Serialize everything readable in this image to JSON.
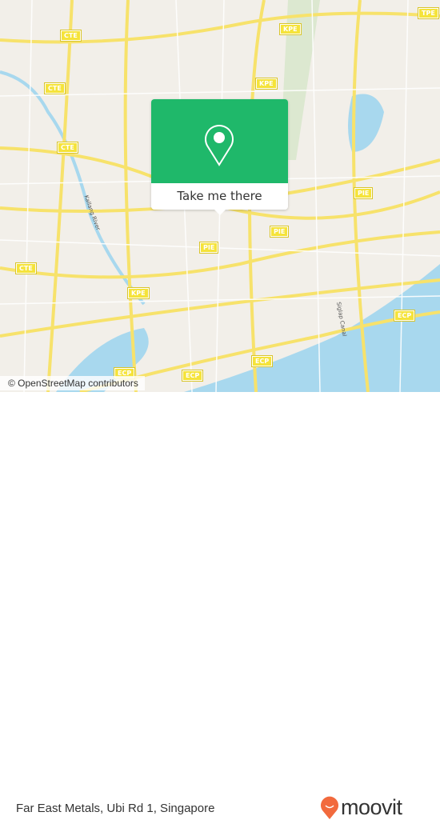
{
  "map": {
    "attribution": "© OpenStreetMap contributors",
    "road_shields": {
      "cte": "CTE",
      "kpe": "KPE",
      "tpe": "TPE",
      "pie": "PIE",
      "ecp": "ECP"
    },
    "road_labels": {
      "kallang": "Kallang River",
      "siglap": "Siglap Canal"
    },
    "colors": {
      "land": "#f2efe9",
      "water": "#a8d8ee",
      "road": "#f7e26b",
      "park": "#cfe8b9"
    }
  },
  "popup": {
    "button_label": "Take me there",
    "color": "#1fb86a",
    "icon": "map-pin-icon"
  },
  "footer": {
    "place_name": "Far East Metals, Ubi Rd 1, Singapore",
    "brand": "moovit",
    "brand_color": "#f26a3d"
  }
}
